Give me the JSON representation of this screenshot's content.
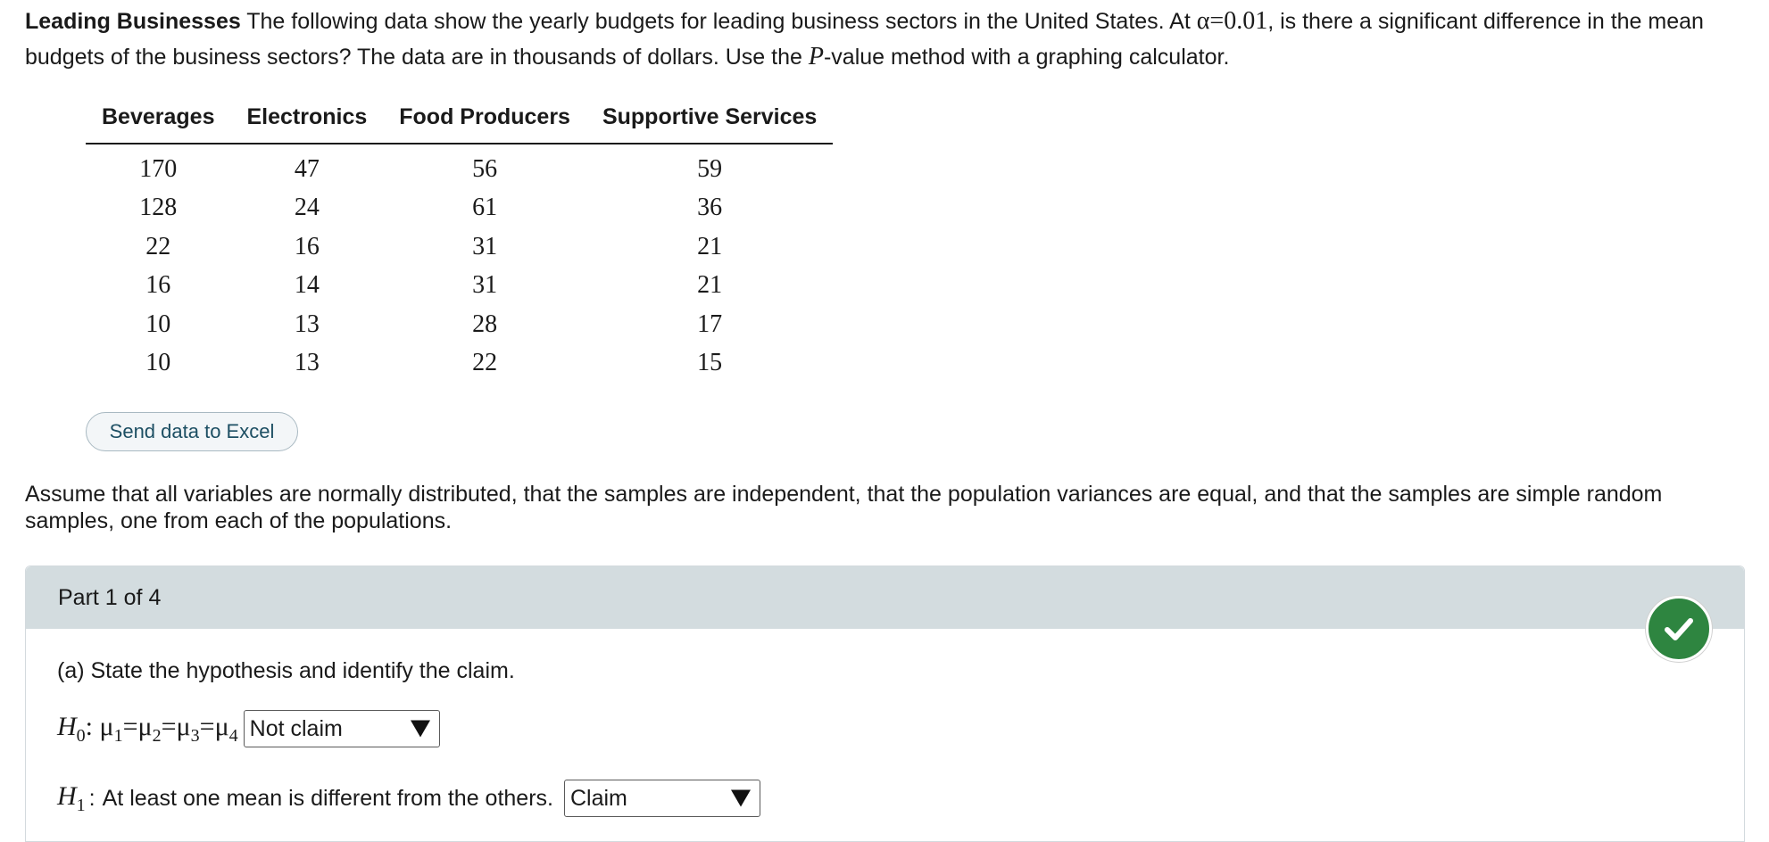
{
  "prompt": {
    "title": "Leading Businesses",
    "text_1": " The following data show the yearly budgets for leading business sectors in the United States. At ",
    "alpha_symbol": "α",
    "alpha_value": "0.01",
    "text_2": ", is there a significant difference in the mean budgets of the business sectors? The data are in thousands of dollars. Use the ",
    "p_symbol": "P",
    "text_3": "-value method with a graphing calculator."
  },
  "table": {
    "headers": [
      "Beverages",
      "Electronics",
      "Food Producers",
      "Supportive Services"
    ],
    "rows": [
      [
        "170",
        "47",
        "56",
        "59"
      ],
      [
        "128",
        "24",
        "61",
        "36"
      ],
      [
        "22",
        "16",
        "31",
        "21"
      ],
      [
        "16",
        "14",
        "31",
        "21"
      ],
      [
        "10",
        "13",
        "28",
        "17"
      ],
      [
        "10",
        "13",
        "22",
        "15"
      ]
    ]
  },
  "excel_button": {
    "label": "Send data to Excel"
  },
  "assumption": "Assume that all variables are normally distributed, that the samples are independent, that the population variances are equal, and that the samples are simple random samples, one from each of the populations.",
  "part": {
    "header": "Part 1 of 4",
    "status_icon": "check-circle-icon",
    "status_color": "#2e8540",
    "question": "(a) State the hypothesis and identify the claim.",
    "h0": {
      "label": "H",
      "sub": "0",
      "colon": ":",
      "mu": "μ",
      "eq": "=",
      "s1": "1",
      "s2": "2",
      "s3": "3",
      "s4": "4",
      "selected": "Not claim"
    },
    "h1": {
      "label": "H",
      "sub": "1",
      "colon": ":",
      "text": "At least one mean is different from the others.",
      "selected": "Claim"
    }
  }
}
